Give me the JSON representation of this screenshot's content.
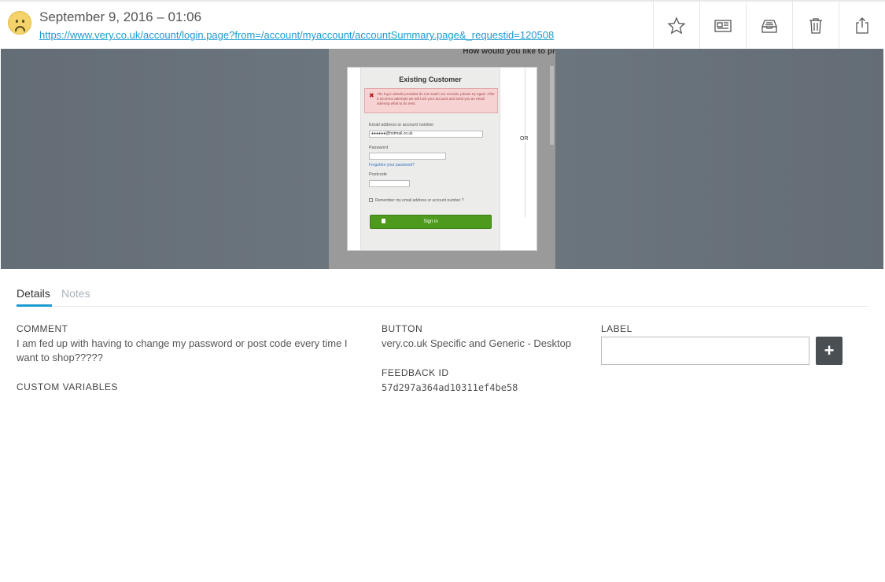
{
  "header": {
    "title": "September 9, 2016 – 01:06",
    "url": "https://www.very.co.uk/account/login.page?from=/account/myaccount/accountSummary.page&_requestid=120508",
    "sentiment_icon": "sad-face-icon",
    "toolbar": [
      {
        "name": "star-icon"
      },
      {
        "name": "newspaper-icon"
      },
      {
        "name": "archive-tray-icon"
      },
      {
        "name": "trash-icon"
      },
      {
        "name": "share-icon"
      }
    ]
  },
  "screenshot": {
    "heading": "How would you like to pr",
    "form_title": "Existing Customer",
    "error": "The log in details provided do not match our records, please try again. After 5 incorrect attempts we will lock your account and send you an email advising what to do next.",
    "email_label": "Email address or account number",
    "email_value": "●●●●●●@hotmail.co.uk",
    "password_label": "Password",
    "forgot_link": "Forgotten your password?",
    "postcode_label": "Postcode",
    "remember_label": "Remember my email address or account number ?",
    "signin_label": "Sign in",
    "or_label": "OR"
  },
  "tabs": [
    {
      "label": "Details",
      "active": true
    },
    {
      "label": "Notes",
      "active": false
    }
  ],
  "details": {
    "comment_label": "COMMENT",
    "comment_value": "I am fed up with having to change my password or post code every time I want to shop?????",
    "custom_variables_label": "CUSTOM VARIABLES",
    "button_label": "BUTTON",
    "button_value": "very.co.uk Specific and Generic - Desktop",
    "feedback_id_label": "FEEDBACK ID",
    "feedback_id_value": "57d297a364ad10311ef4be58",
    "label_label": "LABEL",
    "label_value": "",
    "add_icon": "plus-icon"
  },
  "colors": {
    "accent": "#1a9ad0",
    "screenshot_bg": "#6b747c",
    "add_button": "#4a4f54",
    "signin_green": "#4d9a1c"
  }
}
